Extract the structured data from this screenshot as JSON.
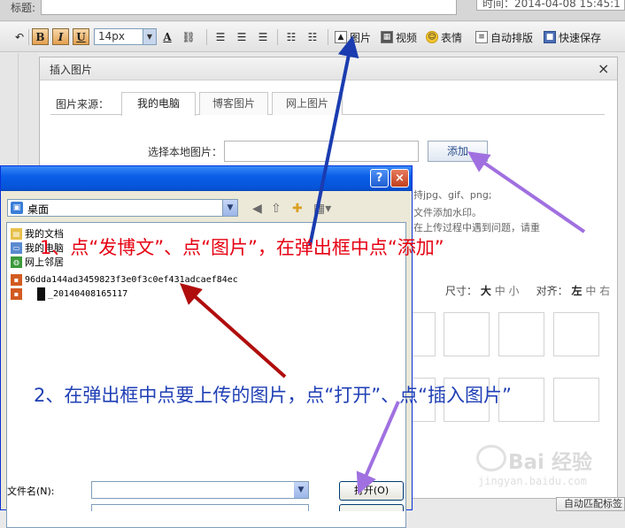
{
  "topbar": {
    "title_label": "标题:",
    "time_text": "时间：2014-04-08 15:45:1"
  },
  "toolbar": {
    "bold": "B",
    "italic": "I",
    "underline": "U",
    "font_size": "14px",
    "font_color_glyph": "A",
    "image_label": "图片",
    "video_label": "视频",
    "emoji_label": "表情",
    "autolayout_label": "自动排版",
    "quicksave_label": "快速保存"
  },
  "insert_dialog": {
    "title": "插入图片",
    "close": "×",
    "source_label": "图片来源：",
    "tabs": [
      "我的电脑",
      "博客图片",
      "网上图片"
    ],
    "local_label": "选择本地图片：",
    "add_button": "添加",
    "hints": [
      "持jpg、gif、png;",
      "文件添加水印。",
      "在上传过程中遇到问题，请重"
    ],
    "size_label": "尺寸：",
    "size_options": [
      "大",
      "中",
      "小"
    ],
    "align_label": "对齐：",
    "align_options": [
      "左",
      "中",
      "右"
    ]
  },
  "file_dialog": {
    "help": "?",
    "close": "×",
    "look_in": "桌面",
    "items": [
      {
        "name": "我的文档",
        "icon": "folder-icon"
      },
      {
        "name": "我的电脑",
        "icon": "computer-icon"
      },
      {
        "name": "网上邻居",
        "icon": "network-icon"
      },
      {
        "name": "96dda144ad3459823f3e0f3c0ef431adcaef84ec",
        "icon": "image-file-icon"
      },
      {
        "name": "_20140408165117",
        "icon": "image-file-icon"
      }
    ],
    "filename_label": "文件名(N):",
    "open_button": "打开(O)"
  },
  "editor": {
    "auto_match_button": "自动匹配标签"
  },
  "annotations": {
    "step1": "1、点“发博文”、点“图片”，在弹出框中点“添加”",
    "step2": "2、在弹出框中点要上传的图片，点“打开”、点“插入图片”"
  },
  "watermark": {
    "brand": "Bai 经验",
    "url": "jingyan.baidu.com"
  },
  "colors": {
    "annotation_red": "#e60012",
    "annotation_blue": "#1f3fb5",
    "arrow_darkred": "#b00d0d",
    "arrow_purple": "#a070e0",
    "xp_titlebar": "#0a5ee8"
  }
}
